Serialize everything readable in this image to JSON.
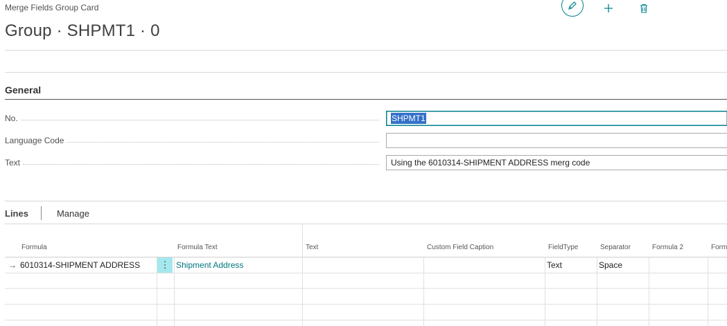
{
  "header": {
    "breadcrumb": "Merge Fields Group Card",
    "title": "Group · SHPMT1 · 0"
  },
  "general": {
    "section_title": "General",
    "fields": [
      {
        "label": "No.",
        "value": "SHPMT1"
      },
      {
        "label": "Language Code",
        "value": ""
      },
      {
        "label": "Text",
        "value": "Using the 6010314-SHIPMENT ADDRESS merg code"
      }
    ]
  },
  "lines": {
    "tab_label": "Lines",
    "manage_label": "Manage",
    "columns": [
      "Formula",
      "Formula Text",
      "Text",
      "Custom Field Caption",
      "FieldType",
      "Separator",
      "Formula 2",
      "Form"
    ],
    "rows": [
      {
        "arrow": "→",
        "formula": "6010314-SHIPMENT ADDRESS",
        "menu": "⋮",
        "formula_text": "Shipment Address",
        "text": "",
        "custom_field_caption": "",
        "field_type": "Text",
        "separator": "Space",
        "formula_2": ""
      }
    ]
  },
  "icons": {
    "edit": "pencil-icon",
    "add": "plus-icon",
    "delete": "trash-icon"
  },
  "colors": {
    "accent": "#00828d",
    "selection": "#3370c9",
    "row_menu": "#a4e8ee"
  }
}
